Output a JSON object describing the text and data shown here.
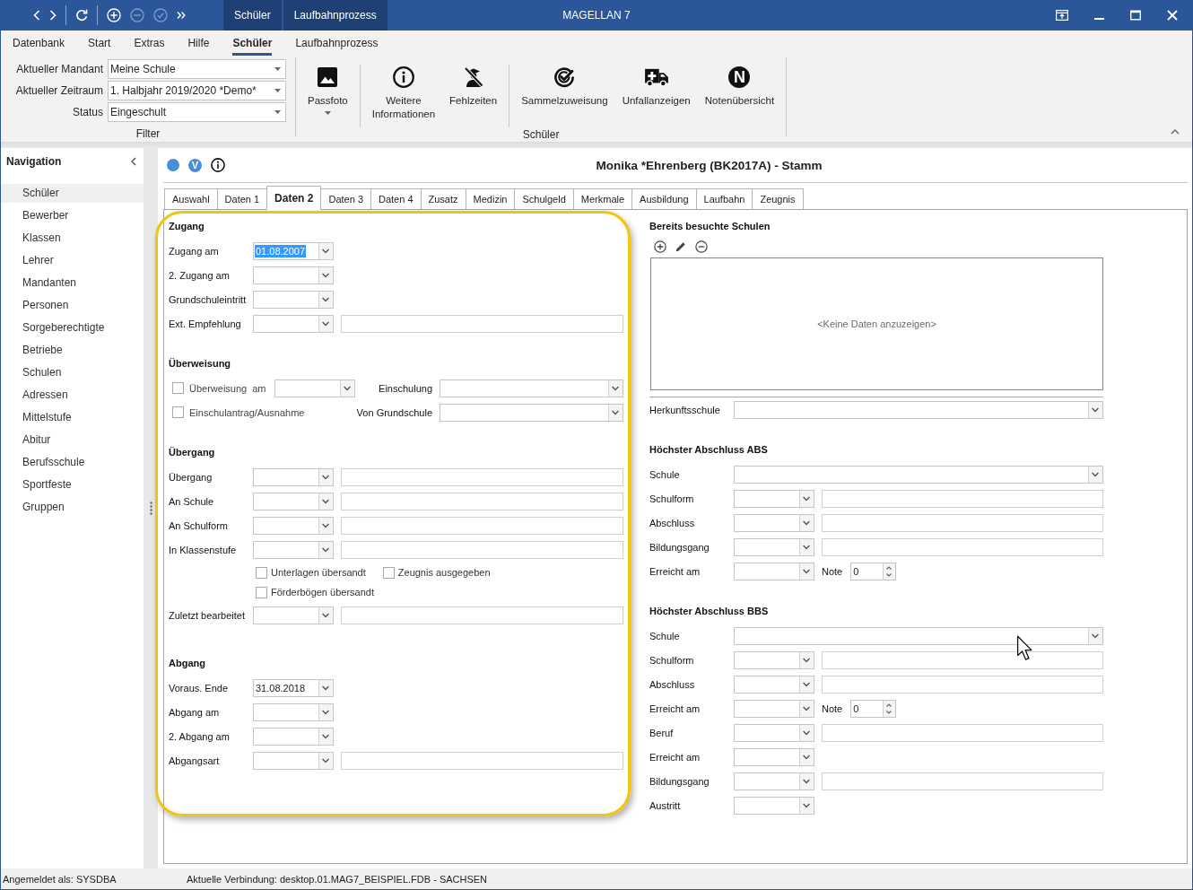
{
  "title_bar": {
    "quick_access": [
      {
        "kind": "back",
        "disabled": false
      },
      {
        "kind": "forward",
        "disabled": false
      },
      {
        "kind": "refresh",
        "disabled": false
      },
      {
        "kind": "add",
        "disabled": false
      },
      {
        "kind": "remove",
        "disabled": true
      },
      {
        "kind": "confirm",
        "disabled": true
      },
      {
        "kind": "more",
        "disabled": false
      }
    ],
    "context_tabs": [
      "Schüler",
      "Laufbahnprozess"
    ],
    "title": "MAGELLAN 7"
  },
  "ribbon": {
    "tabs": [
      {
        "label": "Datenbank",
        "selected": false
      },
      {
        "label": "Start",
        "selected": false
      },
      {
        "label": "Extras",
        "selected": false
      },
      {
        "label": "Hilfe",
        "selected": false
      },
      {
        "label": "Schüler",
        "selected": true
      },
      {
        "label": "Laufbahnprozess",
        "selected": false
      }
    ],
    "filter": {
      "fields": [
        {
          "label": "Aktueller Mandant",
          "value": "Meine Schule"
        },
        {
          "label": "Aktueller Zeitraum",
          "value": "1. Halbjahr 2019/2020 *Demo*"
        },
        {
          "label": "Status",
          "value": "Eingeschult"
        }
      ],
      "group_label": "Filter"
    },
    "actions": {
      "groups": [
        {
          "buttons": [
            {
              "kind": "photo",
              "label": "Passfoto",
              "menu": true
            }
          ]
        },
        {
          "buttons": [
            {
              "kind": "info",
              "label": "Weitere Informationen",
              "menu": false
            },
            {
              "kind": "absence",
              "label": "Fehlzeiten",
              "menu": false
            }
          ]
        },
        {
          "buttons": [
            {
              "kind": "assign",
              "label": "Sammelzuweisung",
              "menu": false
            },
            {
              "kind": "ambulance",
              "label": "Unfallanzeigen",
              "menu": false
            },
            {
              "kind": "letter",
              "label": "Notenübersicht",
              "badge": "N",
              "menu": false
            }
          ]
        }
      ],
      "group_label": "Schüler"
    }
  },
  "navigation": {
    "title": "Navigation",
    "items": [
      {
        "label": "Schüler",
        "selected": true
      },
      {
        "label": "Bewerber",
        "selected": false
      },
      {
        "label": "Klassen",
        "selected": false
      },
      {
        "label": "Lehrer",
        "selected": false
      },
      {
        "label": "Mandanten",
        "selected": false
      },
      {
        "label": "Personen",
        "selected": false
      },
      {
        "label": "Sorgeberechtigte",
        "selected": false
      },
      {
        "label": "Betriebe",
        "selected": false
      },
      {
        "label": "Schulen",
        "selected": false
      },
      {
        "label": "Adressen",
        "selected": false
      },
      {
        "label": "Mittelstufe",
        "selected": false
      },
      {
        "label": "Abitur",
        "selected": false
      },
      {
        "label": "Berufsschule",
        "selected": false
      },
      {
        "label": "Sportfeste",
        "selected": false
      },
      {
        "label": "Gruppen",
        "selected": false
      }
    ]
  },
  "record": {
    "marker_letter": "V",
    "title": "Monika *Ehrenberg (BK2017A) - Stamm",
    "tabs": [
      {
        "label": "Auswahl",
        "selected": false
      },
      {
        "label": "Daten 1",
        "selected": false
      },
      {
        "label": "Daten 2",
        "selected": true
      },
      {
        "label": "Daten 3",
        "selected": false
      },
      {
        "label": "Daten 4",
        "selected": false
      },
      {
        "label": "Zusatz",
        "selected": false
      },
      {
        "label": "Medizin",
        "selected": false
      },
      {
        "label": "Schulgeld",
        "selected": false
      },
      {
        "label": "Merkmale",
        "selected": false
      },
      {
        "label": "Ausbildung",
        "selected": false
      },
      {
        "label": "Laufbahn",
        "selected": false
      },
      {
        "label": "Zeugnis",
        "selected": false
      }
    ],
    "columns": [
      {
        "sections": [
          {
            "title": "Zugang",
            "rows": [
              {
                "kind": "combo",
                "label": "Zugang am",
                "value": "01.08.2007",
                "text_selected": true
              },
              {
                "kind": "combo",
                "label": "2. Zugang am"
              },
              {
                "kind": "combo",
                "label": "Grundschuleintritt"
              },
              {
                "kind": "combo_text",
                "label": "Ext. Empfehlung"
              }
            ]
          },
          {
            "title": "Überweisung",
            "rows": [
              {
                "kind": "transfer",
                "checked": false,
                "label": "Überweisung",
                "date_label": "am",
                "right_label": "Einschulung"
              },
              {
                "kind": "transfer",
                "checked": false,
                "label": "Einschulantrag/Ausnahme",
                "right_label": "Von Grundschule"
              }
            ]
          },
          {
            "title": "Übergang",
            "rows": [
              {
                "kind": "combo_text",
                "label": "Übergang"
              },
              {
                "kind": "combo_text",
                "label": "An Schule"
              },
              {
                "kind": "combo_text",
                "label": "An Schulform"
              },
              {
                "kind": "combo_text",
                "label": "In Klassenstufe"
              },
              {
                "kind": "checks",
                "items": [
                  {
                    "label": "Unterlagen übersandt",
                    "checked": false
                  },
                  {
                    "label": "Zeugnis ausgegeben",
                    "checked": false
                  }
                ]
              },
              {
                "kind": "checks",
                "items": [
                  {
                    "label": "Förderbögen übersandt",
                    "checked": false
                  }
                ]
              },
              {
                "kind": "combo_text",
                "label": "Zuletzt bearbeitet"
              }
            ]
          },
          {
            "title": "Abgang",
            "rows": [
              {
                "kind": "combo",
                "label": "Voraus. Ende",
                "value": "31.08.2018",
                "text_selected": false
              },
              {
                "kind": "combo",
                "label": "Abgang am"
              },
              {
                "kind": "combo",
                "label": "2. Abgang am"
              },
              {
                "kind": "combo_text",
                "label": "Abgangsart"
              }
            ]
          }
        ]
      },
      {
        "sections": [
          {
            "title": "Bereits besuchte Schulen",
            "grid": {
              "empty_text": "<Keine Daten anzuzeigen>"
            },
            "rows": [
              {
                "kind": "wide",
                "label": "Herkunftsschule"
              }
            ]
          },
          {
            "title": "Höchster Abschluss ABS",
            "rows": [
              {
                "kind": "wide",
                "label": "Schule"
              },
              {
                "kind": "combo_text",
                "label": "Schulform"
              },
              {
                "kind": "combo_text",
                "label": "Abschluss"
              },
              {
                "kind": "combo_text",
                "label": "Bildungsgang"
              },
              {
                "kind": "grade",
                "label": "Erreicht am",
                "grade_label": "Note",
                "grade": "0"
              }
            ]
          },
          {
            "title": "Höchster Abschluss BBS",
            "rows": [
              {
                "kind": "wide",
                "label": "Schule"
              },
              {
                "kind": "combo_text",
                "label": "Schulform"
              },
              {
                "kind": "combo_text",
                "label": "Abschluss"
              },
              {
                "kind": "grade",
                "label": "Erreicht am",
                "grade_label": "Note",
                "grade": "0"
              },
              {
                "kind": "combo_text",
                "label": "Beruf"
              },
              {
                "kind": "combo",
                "label": "Erreicht am"
              },
              {
                "kind": "combo_text",
                "label": "Bildungsgang"
              },
              {
                "kind": "combo",
                "label": "Austritt"
              }
            ]
          }
        ]
      }
    ]
  },
  "status_bar": {
    "user": "Angemeldet als: SYSDBA",
    "connection": "Aktuelle Verbindung: desktop.01.MAG7_BEISPIEL.FDB - SACHSEN"
  }
}
